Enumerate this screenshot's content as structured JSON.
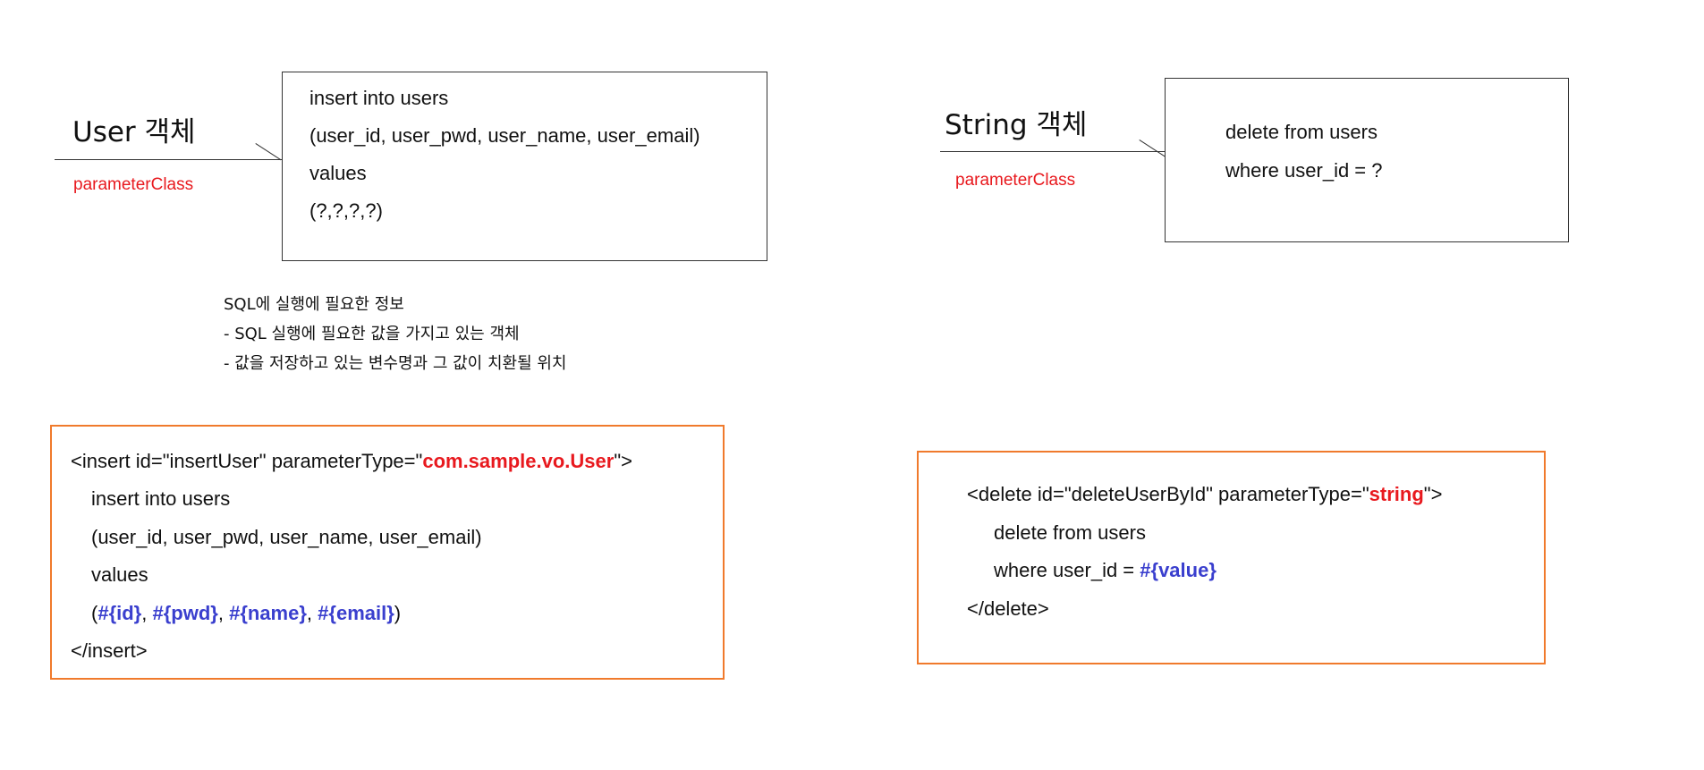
{
  "left": {
    "object_label": "User 객체",
    "param_label": "parameterClass",
    "sql_lines": [
      "insert into users",
      "(user_id, user_pwd, user_name, user_email)",
      "values",
      "(?,?,?,?)"
    ],
    "notes": [
      "SQL에 실행에 필요한 정보",
      "- SQL 실행에 필요한 값을 가지고 있는 객체",
      "- 값을 저장하고 있는 변수명과 그 값이 치환될 위치"
    ],
    "code": {
      "open_prefix": "<insert id=\"insertUser\" parameterType=\"",
      "open_type": "com.sample.vo.User",
      "open_suffix": "\">",
      "line1": "insert into users",
      "line2": "(user_id, user_pwd, user_name, user_email)",
      "line3": "values",
      "values_open": "(",
      "p_id": "#{id}",
      "p_pwd": "#{pwd}",
      "p_name": "#{name}",
      "p_email": "#{email}",
      "sep": ", ",
      "values_close": ")",
      "close": "</insert>"
    }
  },
  "right": {
    "object_label": "String 객체",
    "param_label": "parameterClass",
    "sql_lines": [
      "delete from users",
      "where user_id = ?"
    ],
    "code": {
      "open_prefix": "<delete id=\"deleteUserById\"  parameterType=\"",
      "open_type": "string",
      "open_suffix": "\">",
      "line1": "delete from users",
      "line2_prefix": "where user_id =  ",
      "line2_param": "#{value}",
      "close": "</delete>"
    }
  },
  "colors": {
    "param_label": "#e8191e",
    "code_border": "#f07a2c",
    "type_highlight": "#e8191e",
    "param_highlight": "#3a3fce"
  }
}
